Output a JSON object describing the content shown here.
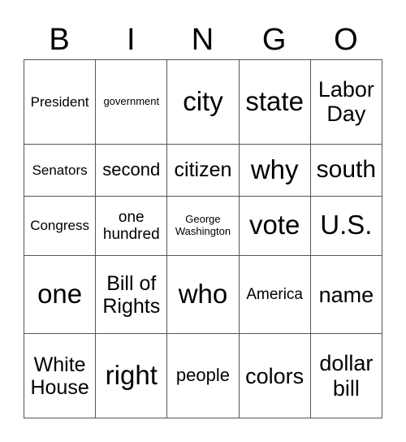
{
  "header": [
    "B",
    "I",
    "N",
    "G",
    "O"
  ],
  "rows": [
    [
      "President",
      "government",
      "city",
      "state",
      "Labor Day"
    ],
    [
      "Senators",
      "second",
      "citizen",
      "why",
      "south"
    ],
    [
      "Congress",
      "one hundred",
      "George Washington",
      "vote",
      "U.S."
    ],
    [
      "one",
      "Bill of Rights",
      "who",
      "America",
      "name"
    ],
    [
      "White House",
      "right",
      "people",
      "colors",
      "dollar bill"
    ]
  ]
}
